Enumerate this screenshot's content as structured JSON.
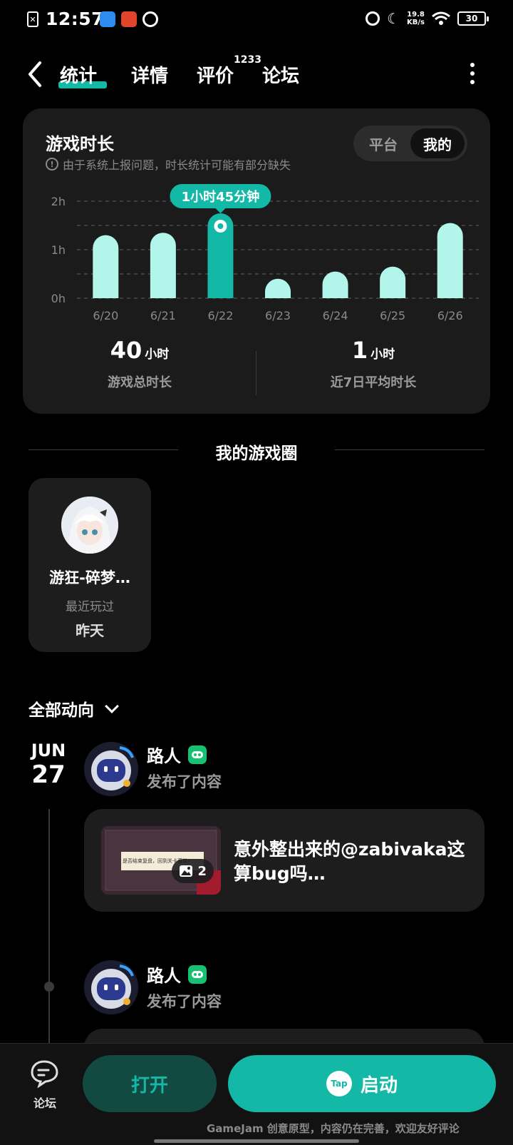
{
  "status_bar": {
    "time": "12:57",
    "net_speed_value": "19.8",
    "net_speed_unit": "KB/s",
    "battery": "30"
  },
  "nav": {
    "tabs": [
      {
        "label": "统计",
        "active": true
      },
      {
        "label": "详情",
        "active": false
      },
      {
        "label": "评价",
        "active": false,
        "badge": "1233"
      },
      {
        "label": "论坛",
        "active": false
      }
    ]
  },
  "stats_card": {
    "title": "游戏时长",
    "note": "由于系统上报问题，时长统计可能有部分缺失",
    "segments": [
      "平台",
      "我的"
    ],
    "selected_segment": "我的",
    "tooltip": "1小时45分钟",
    "total": {
      "value": "40",
      "unit": "小时",
      "label": "游戏总时长"
    },
    "average": {
      "value": "1",
      "unit": "小时",
      "label": "近7日平均时长"
    }
  },
  "chart_data": {
    "type": "bar",
    "categories": [
      "6/20",
      "6/21",
      "6/22",
      "6/23",
      "6/24",
      "6/25",
      "6/26"
    ],
    "values": [
      1.3,
      1.35,
      1.75,
      0.4,
      0.55,
      0.65,
      1.55
    ],
    "highlight_index": 2,
    "y_ticks": [
      "0h",
      "1h",
      "2h"
    ],
    "ylim": [
      0,
      2
    ],
    "grid": true,
    "colors": {
      "bar": "#b2f5ea",
      "highlight": "#14b8a6"
    }
  },
  "game_circle": {
    "section_title": "我的游戏圈",
    "game_name": "游狂-碎梦…",
    "sub": "最近玩过",
    "when": "昨天"
  },
  "activity": {
    "header": "全部动向",
    "date_month": "JUN",
    "date_day": "27",
    "posts": [
      {
        "author": "路人",
        "action": "发布了内容",
        "text": "意外整出来的@zabivaka这算bug吗…",
        "image_count": "2",
        "thumb_caption": "是否结束复盘，回到关卡菜单?"
      },
      {
        "author": "路人",
        "action": "发布了内容"
      }
    ]
  },
  "bottom_bar": {
    "forum_label": "论坛",
    "open_label": "打开",
    "launch_label": "启动",
    "tap_icon_text": "Tap",
    "footer_note": "GameJam 创意原型，内容仍在完善，欢迎友好评论"
  },
  "colors": {
    "accent": "#14b8a6",
    "card": "#1b1b1b",
    "background": "#000000"
  }
}
